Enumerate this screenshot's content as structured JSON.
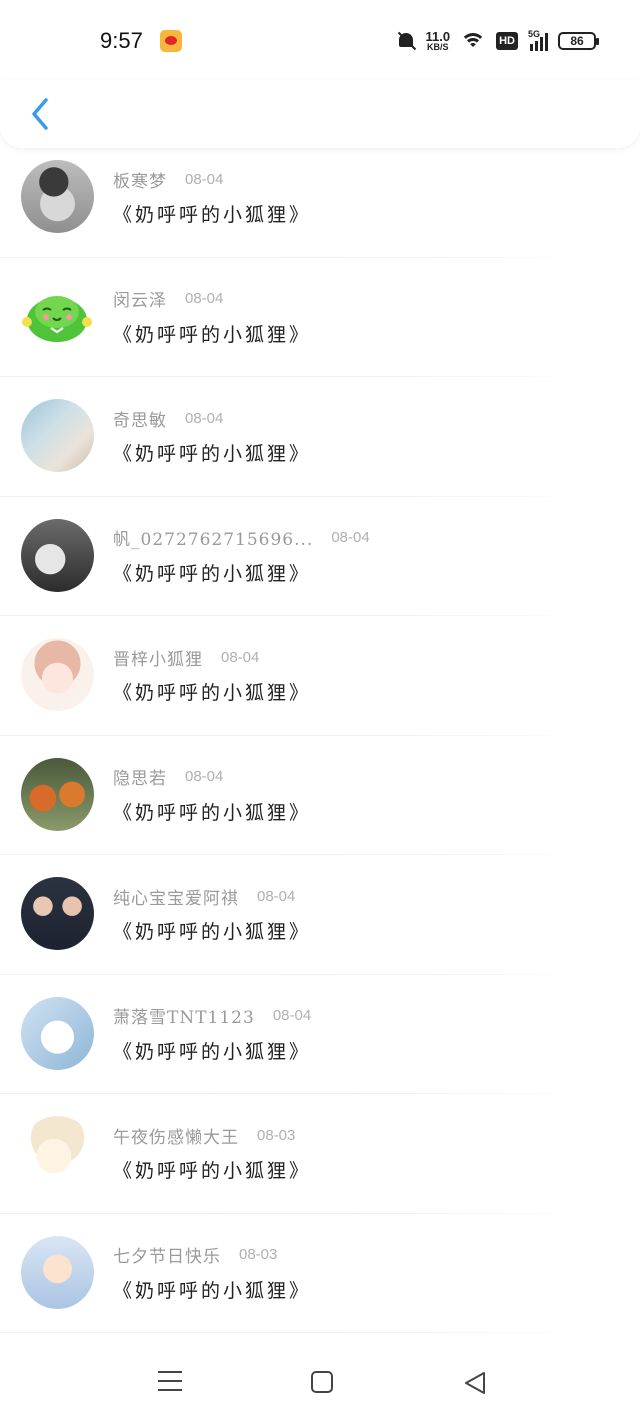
{
  "status_bar": {
    "time": "9:57",
    "net_speed": "11.0",
    "net_speed_unit": "KB/S",
    "hd_label": "HD",
    "network_label": "5G",
    "battery": "86",
    "icons": [
      "weibo-icon",
      "bell-off-icon",
      "wifi-icon",
      "hd-icon",
      "signal-icon",
      "battery-icon"
    ]
  },
  "header": {
    "back_icon": "chevron-left-icon",
    "accent_color": "#3a9be8"
  },
  "list": {
    "items": [
      {
        "name": "板寒梦",
        "date": "08-04",
        "title": "《奶呼呼的小狐狸》"
      },
      {
        "name": "闵云泽",
        "date": "08-04",
        "title": "《奶呼呼的小狐狸》"
      },
      {
        "name": "奇思敏",
        "date": "08-04",
        "title": "《奶呼呼的小狐狸》"
      },
      {
        "name": "帆_0272762715696...",
        "date": "08-04",
        "title": "《奶呼呼的小狐狸》"
      },
      {
        "name": "晋梓小狐狸",
        "date": "08-04",
        "title": "《奶呼呼的小狐狸》"
      },
      {
        "name": "隐思若",
        "date": "08-04",
        "title": "《奶呼呼的小狐狸》"
      },
      {
        "name": "纯心宝宝爱阿祺",
        "date": "08-04",
        "title": "《奶呼呼的小狐狸》"
      },
      {
        "name": "萧落雪TNT1123",
        "date": "08-04",
        "title": "《奶呼呼的小狐狸》"
      },
      {
        "name": "午夜伤感懒大王",
        "date": "08-03",
        "title": "《奶呼呼的小狐狸》"
      },
      {
        "name": "七夕节日快乐",
        "date": "08-03",
        "title": "《奶呼呼的小狐狸》"
      }
    ]
  },
  "nav_bar": {
    "icons": [
      "menu-icon",
      "home-square-icon",
      "back-triangle-icon"
    ]
  }
}
